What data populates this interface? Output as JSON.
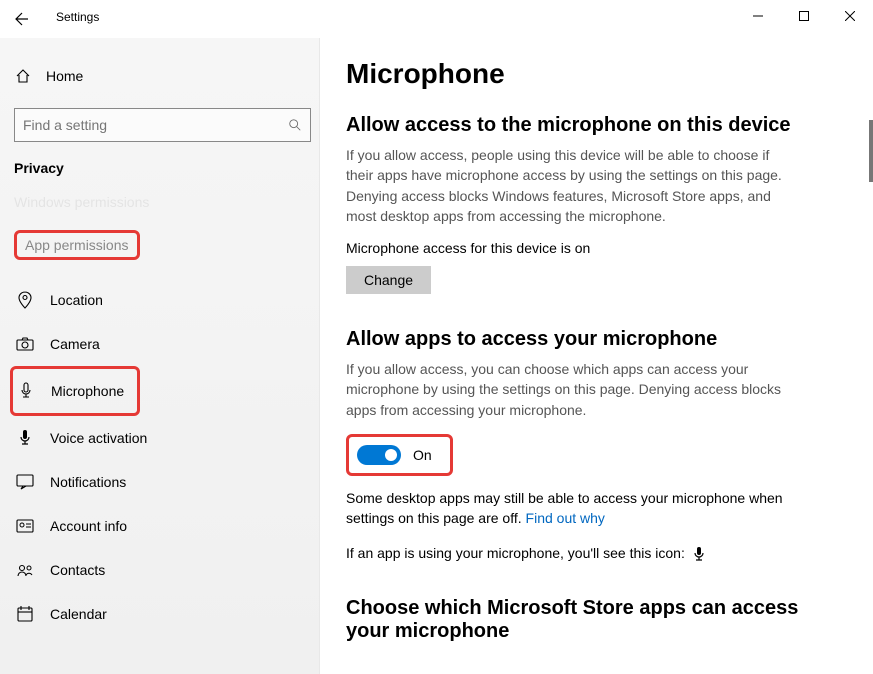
{
  "titlebar": {
    "title": "Settings"
  },
  "sidebar": {
    "home_label": "Home",
    "search_placeholder": "Find a setting",
    "section_label": "Privacy",
    "cutoff_label": "Windows permissions",
    "permissions_label": "App permissions",
    "items": [
      {
        "label": "Location"
      },
      {
        "label": "Camera"
      },
      {
        "label": "Microphone"
      },
      {
        "label": "Voice activation"
      },
      {
        "label": "Notifications"
      },
      {
        "label": "Account info"
      },
      {
        "label": "Contacts"
      },
      {
        "label": "Calendar"
      }
    ]
  },
  "content": {
    "page_title": "Microphone",
    "section1_title": "Allow access to the microphone on this device",
    "section1_body": "If you allow access, people using this device will be able to choose if their apps have microphone access by using the settings on this page. Denying access blocks Windows features, Microsoft Store apps, and most desktop apps from accessing the microphone.",
    "access_status": "Microphone access for this device is on",
    "change_label": "Change",
    "section2_title": "Allow apps to access your microphone",
    "section2_body": "If you allow access, you can choose which apps can access your microphone by using the settings on this page. Denying access blocks apps from accessing your microphone.",
    "toggle_label": "On",
    "desktop_note_a": "Some desktop apps may still be able to access your microphone when settings on this page are off. ",
    "desktop_note_link": "Find out why",
    "usage_note": "If an app is using your microphone, you'll see this icon:",
    "section3_title": "Choose which Microsoft Store apps can access your microphone"
  }
}
